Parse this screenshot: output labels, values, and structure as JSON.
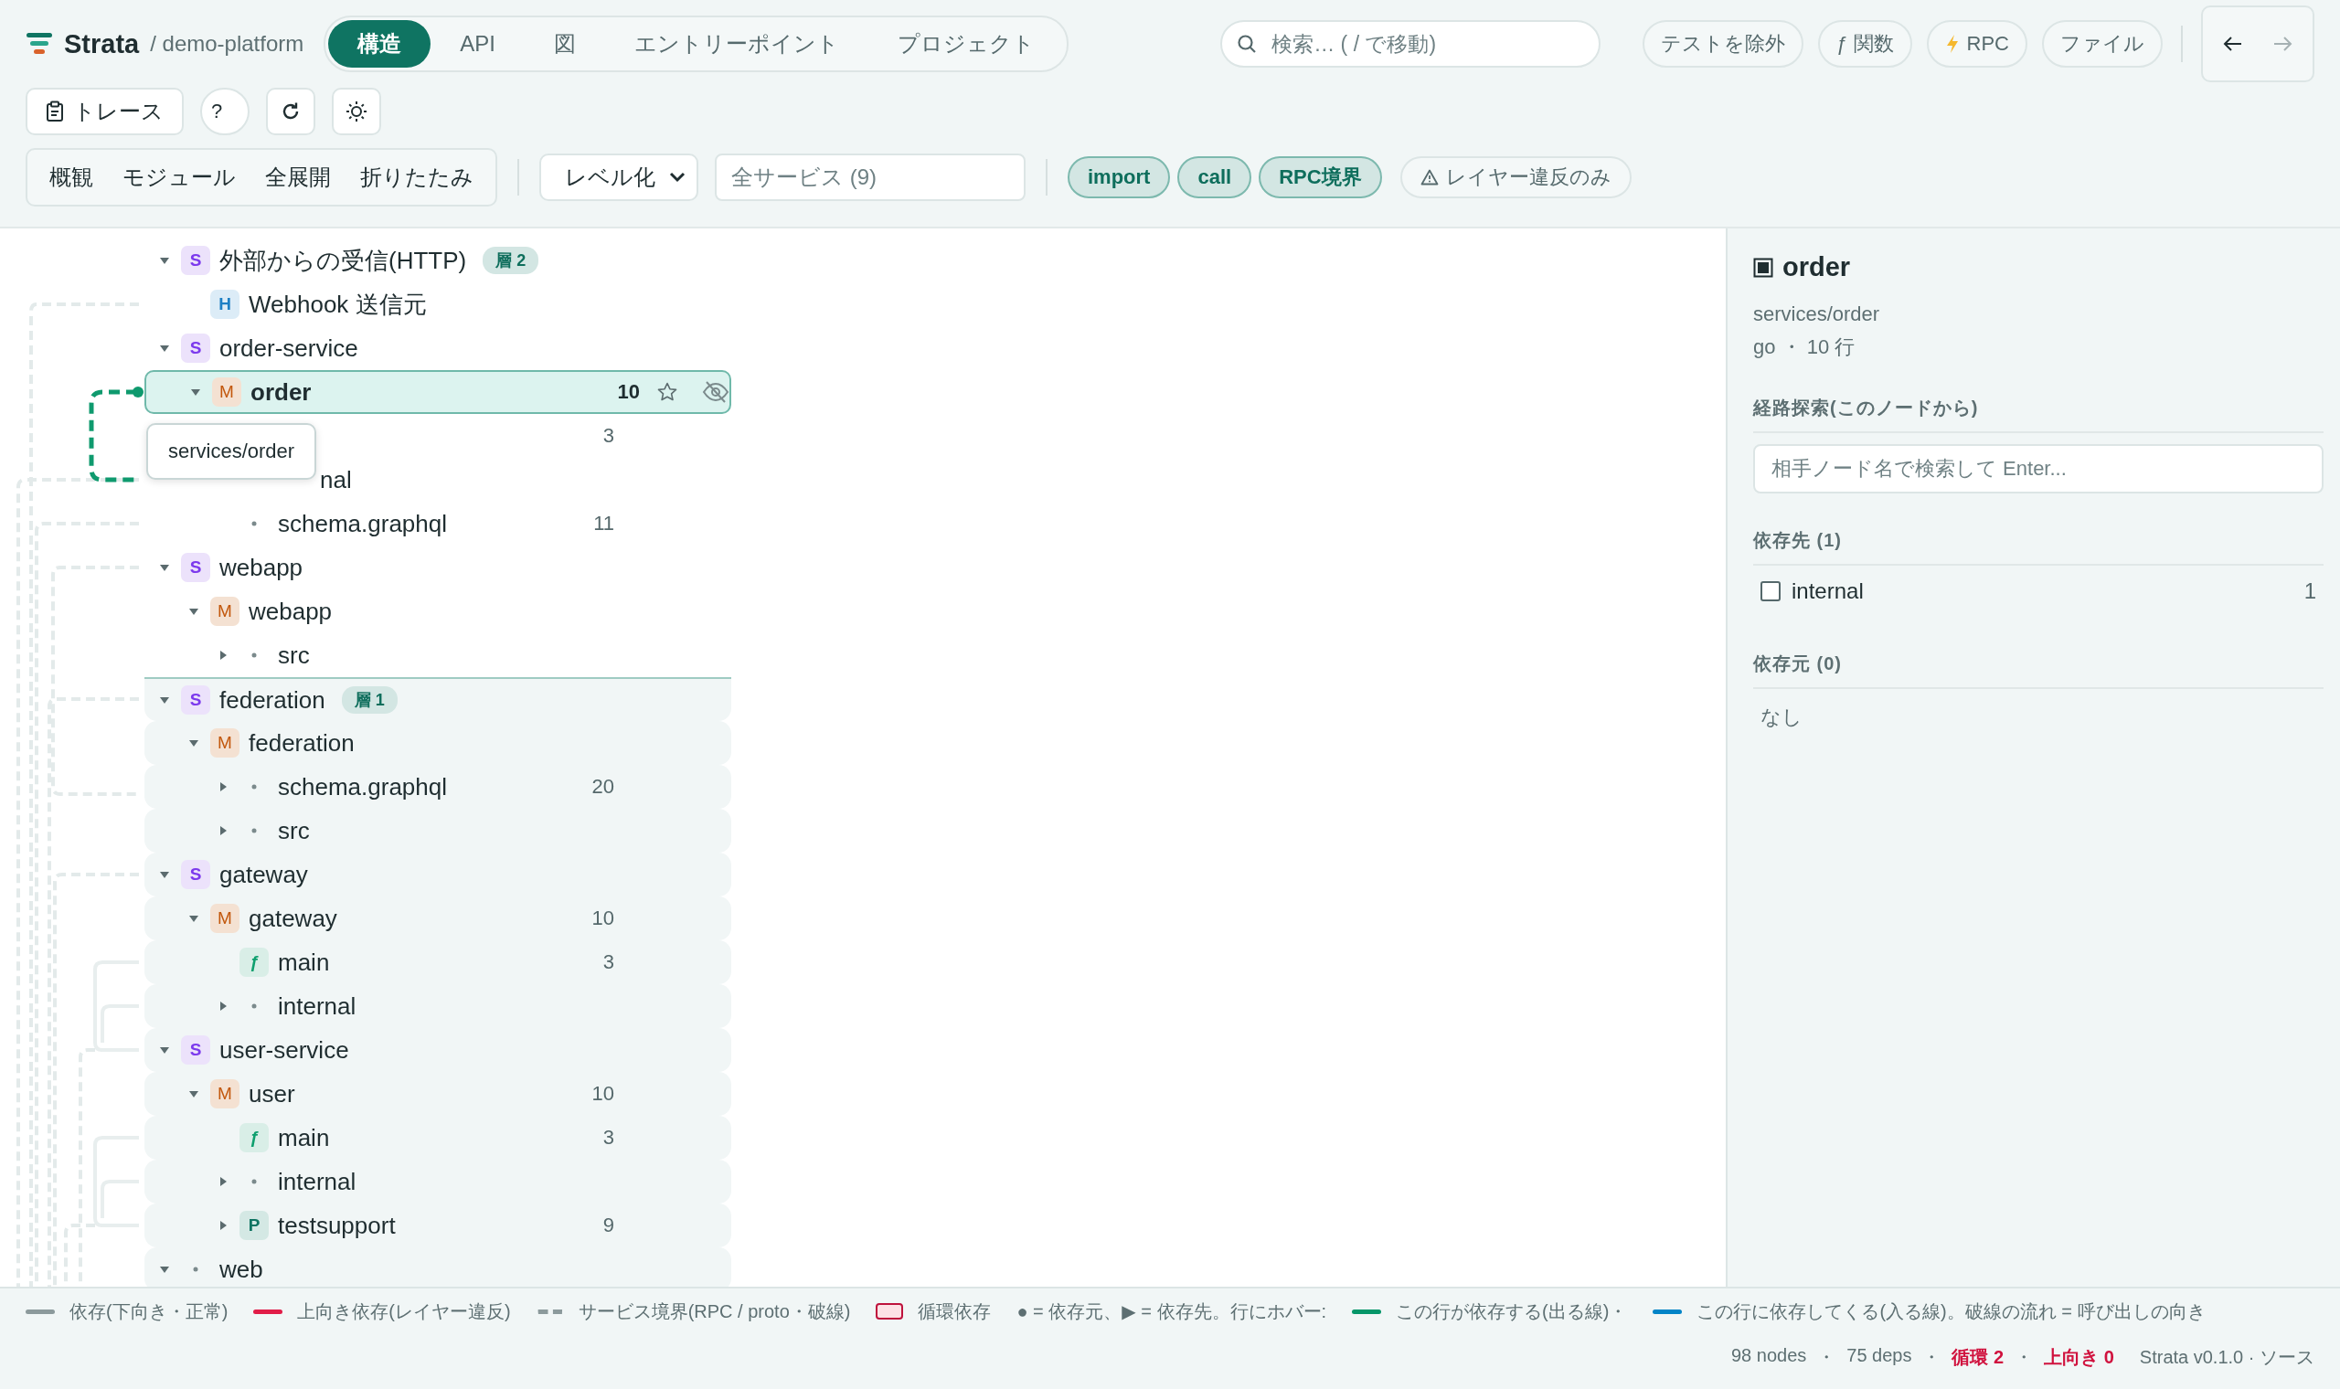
{
  "header": {
    "logo": "Strata",
    "project": "/ demo-platform",
    "nav_tabs": [
      {
        "label": "構造",
        "selected": true
      },
      {
        "label": "API",
        "selected": false
      },
      {
        "label": "図",
        "selected": false
      },
      {
        "label": "エントリーポイント",
        "selected": false
      },
      {
        "label": "プロジェクト",
        "selected": false
      }
    ],
    "search": {
      "placeholder": "検索… ( / で移動)"
    },
    "filter_chips": [
      {
        "label": "テストを除外",
        "kind": "plain"
      },
      {
        "label": "ƒ 関数",
        "kind": "plain"
      },
      {
        "label": "RPC",
        "kind": "rpc"
      },
      {
        "label": "ファイル",
        "kind": "plain"
      }
    ],
    "history": [
      {
        "kind": "back",
        "disabled": false
      },
      {
        "kind": "forward",
        "disabled": true
      }
    ]
  },
  "toolbar": {
    "trace_button": "トレース",
    "help_button": "?"
  },
  "view_buttons": [
    {
      "label": "概観"
    },
    {
      "label": "モジュール"
    },
    {
      "label": "全展開"
    },
    {
      "label": "折りたたみ"
    }
  ],
  "layout_select": {
    "value": "レベル化"
  },
  "service_filter": {
    "placeholder": "全サービス (9)"
  },
  "edge_toggles": [
    {
      "label": "import",
      "on": true,
      "kind": "plain"
    },
    {
      "label": "call",
      "on": true,
      "kind": "plain"
    },
    {
      "label": "RPC境界",
      "on": true,
      "kind": "plain"
    },
    {
      "label": "レイヤー違反のみ",
      "on": false,
      "kind": "warning"
    }
  ],
  "tree": [
    {
      "label": "外部からの受信(HTTP)",
      "kind": "service",
      "letter": "S",
      "expanded": true,
      "selected": false,
      "badge": "層 2",
      "children": [
        {
          "label": "Webhook 送信元",
          "kind": "http",
          "letter": "H",
          "selected": false
        }
      ]
    },
    {
      "label": "order-service",
      "kind": "service",
      "letter": "S",
      "expanded": true,
      "selected": false,
      "children": [
        {
          "label": "order",
          "kind": "module",
          "letter": "M",
          "expanded": true,
          "selected": true,
          "count": "10",
          "tooltip": "services/order",
          "children": [
            {
              "covered": true,
              "count": "3",
              "selected": false
            },
            {
              "label": "nal",
              "covered": true,
              "selected": false
            },
            {
              "label": "schema.graphql",
              "kind": "dir",
              "count": "11",
              "selected": false
            }
          ]
        }
      ]
    },
    {
      "label": "webapp",
      "kind": "service",
      "letter": "S",
      "expanded": true,
      "selected": false,
      "children": [
        {
          "label": "webapp",
          "kind": "module",
          "letter": "M",
          "expanded": true,
          "selected": false,
          "children": [
            {
              "label": "src",
              "kind": "dir",
              "expanded": false,
              "selected": false
            }
          ]
        }
      ]
    },
    {
      "label": "federation",
      "kind": "service",
      "letter": "S",
      "expanded": true,
      "selected": false,
      "badge": "層 1",
      "highlighted": true,
      "children": [
        {
          "label": "federation",
          "kind": "module",
          "letter": "M",
          "expanded": true,
          "highlighted": true,
          "selected": false,
          "children": [
            {
              "label": "schema.graphql",
              "kind": "dir",
              "expanded": false,
              "count": "20",
              "highlighted": true,
              "selected": false
            },
            {
              "label": "src",
              "kind": "dir",
              "expanded": false,
              "highlighted": true,
              "selected": false
            }
          ]
        }
      ]
    },
    {
      "label": "gateway",
      "kind": "service",
      "letter": "S",
      "expanded": true,
      "highlighted": true,
      "selected": false,
      "children": [
        {
          "label": "gateway",
          "kind": "module",
          "letter": "M",
          "expanded": true,
          "count": "10",
          "highlighted": true,
          "selected": false,
          "children": [
            {
              "label": "main",
              "kind": "func",
              "letter": "ƒ",
              "count": "3",
              "highlighted": true,
              "selected": false
            },
            {
              "label": "internal",
              "kind": "dir",
              "expanded": false,
              "highlighted": true,
              "selected": false
            }
          ]
        }
      ]
    },
    {
      "label": "user-service",
      "kind": "service",
      "letter": "S",
      "expanded": true,
      "highlighted": true,
      "selected": false,
      "children": [
        {
          "label": "user",
          "kind": "module",
          "letter": "M",
          "expanded": true,
          "count": "10",
          "highlighted": true,
          "selected": false,
          "children": [
            {
              "label": "main",
              "kind": "func",
              "letter": "ƒ",
              "count": "3",
              "highlighted": true,
              "selected": false
            },
            {
              "label": "internal",
              "kind": "dir",
              "expanded": false,
              "highlighted": true,
              "selected": false
            },
            {
              "label": "testsupport",
              "kind": "package",
              "letter": "P",
              "expanded": false,
              "count": "9",
              "highlighted": true,
              "selected": false
            }
          ]
        }
      ]
    },
    {
      "label": "web",
      "kind": "dir",
      "expanded": true,
      "highlighted": true,
      "selected": false
    }
  ],
  "detail_panel": {
    "title": "order",
    "path": "services/order",
    "meta": "go ・ 10 行",
    "path_search": {
      "heading": "経路探索(このノードから)",
      "placeholder": "相手ノード名で検索して Enter..."
    },
    "dependencies": {
      "heading": "依存先 (1)",
      "items": [
        {
          "label": "internal",
          "count": "1",
          "checked": false
        }
      ]
    },
    "dependents": {
      "heading": "依存元 (0)",
      "empty": "なし"
    }
  },
  "legend": [
    {
      "kind": "solid",
      "color": "#8c9a9c",
      "label": "依存(下向き・正常)"
    },
    {
      "kind": "solid",
      "color": "#e11d48",
      "label": "上向き依存(レイヤー違反)"
    },
    {
      "kind": "dashed",
      "color": "#8c9a9c",
      "label": "サービス境界(RPC / proto・破線)"
    },
    {
      "kind": "box",
      "color": "#be123c",
      "label": "循環依存"
    },
    {
      "kind": "text",
      "label": "● = 依存元、▶ = 依存先。行にホバー:"
    },
    {
      "kind": "solid",
      "color": "#059669",
      "label": "この行が依存する(出る線)・"
    },
    {
      "kind": "solid",
      "color": "#0284c7",
      "label": "この行に依存してくる(入る線)。破線の流れ = 呼び出しの向き"
    }
  ],
  "status_bar": [
    {
      "text": "98 nodes",
      "kind": "plain"
    },
    {
      "text": "・",
      "kind": "separator"
    },
    {
      "text": "75 deps",
      "kind": "plain"
    },
    {
      "text": "・",
      "kind": "separator"
    },
    {
      "text": "循環 2",
      "kind": "alert"
    },
    {
      "text": "・",
      "kind": "separator"
    },
    {
      "text": "上向き 0",
      "kind": "alert"
    },
    {
      "text": "Strata v0.1.0 · ソース",
      "kind": "plain"
    }
  ]
}
